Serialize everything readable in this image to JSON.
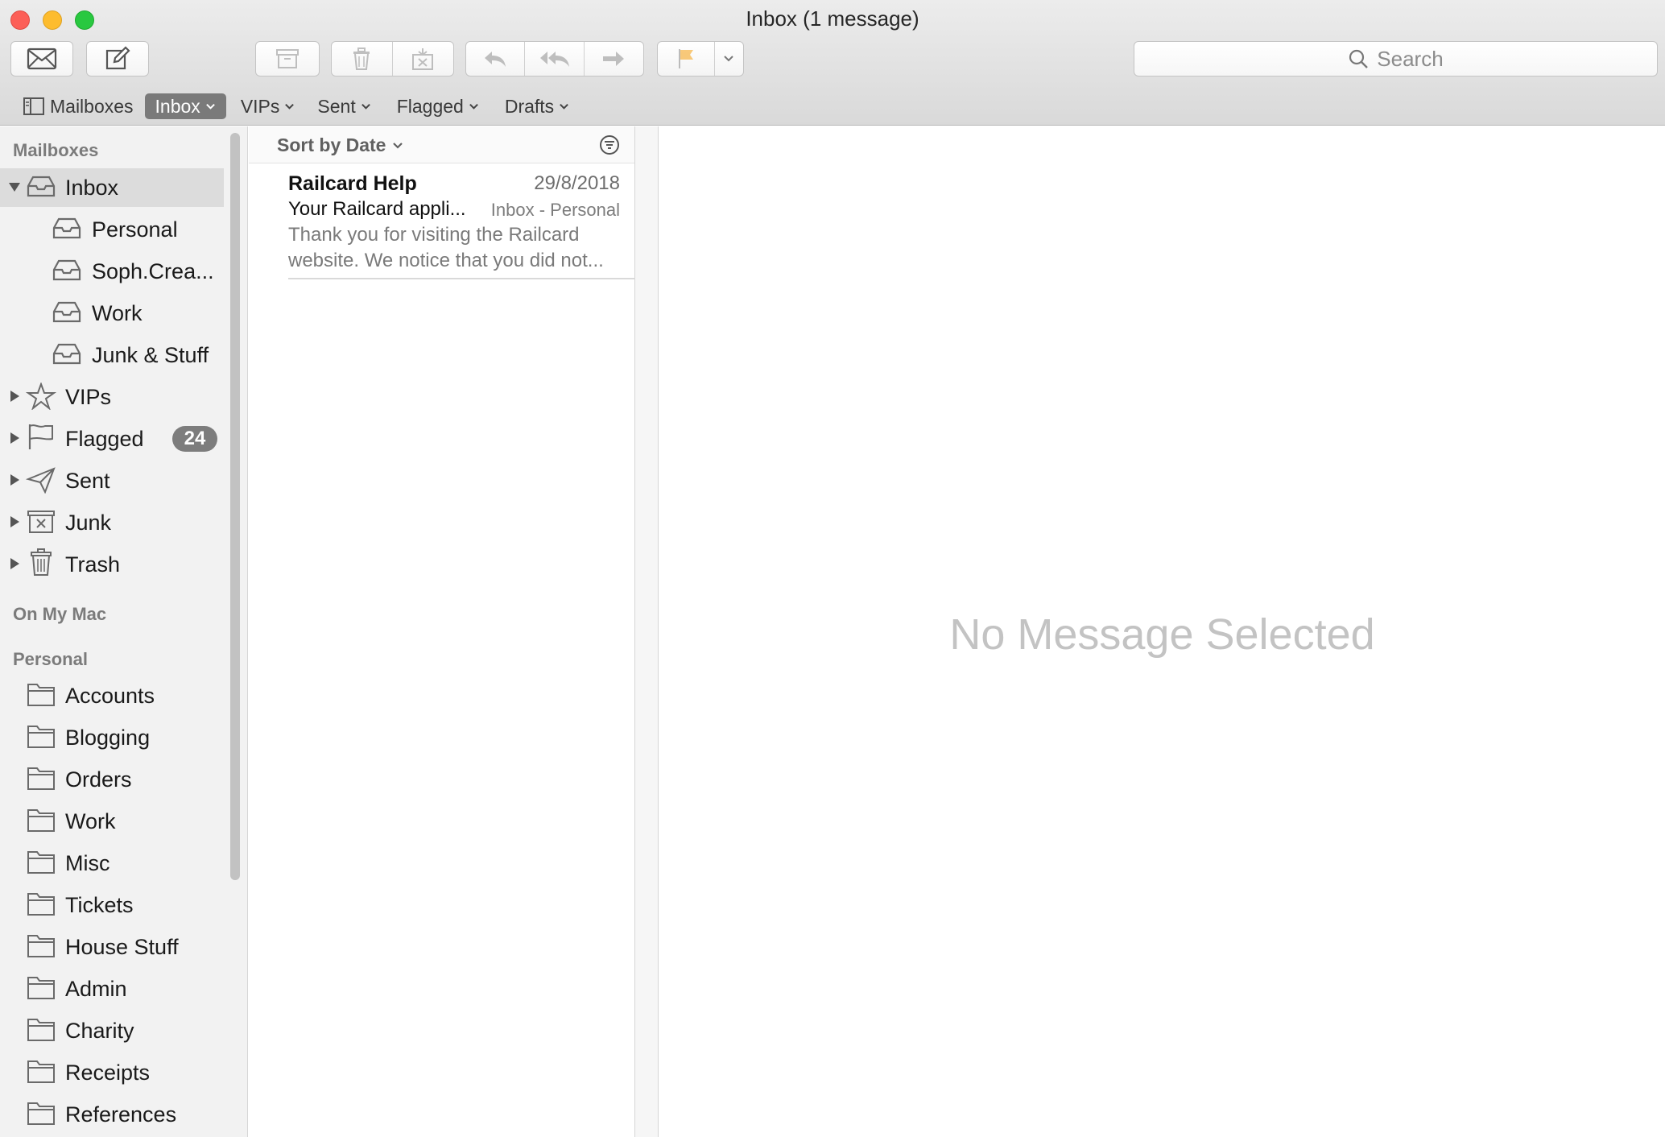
{
  "window": {
    "title": "Inbox (1 message)"
  },
  "toolbar": {
    "icons": [
      "get-mail-icon",
      "compose-icon",
      "archive-icon",
      "trash-icon",
      "junk-icon",
      "reply-icon",
      "reply-all-icon",
      "forward-icon",
      "flag-icon",
      "chevron-down-icon"
    ],
    "flag_color": "#f5a623",
    "search_placeholder": "Search"
  },
  "favorites": {
    "mailboxes": "Mailboxes",
    "inbox": "Inbox",
    "vips": "VIPs",
    "sent": "Sent",
    "flagged": "Flagged",
    "drafts": "Drafts"
  },
  "sidebar": {
    "section_mailboxes": "Mailboxes",
    "inbox": "Inbox",
    "inbox_children": [
      "Personal",
      "Soph.Crea...",
      "Work",
      "Junk & Stuff"
    ],
    "vips": "VIPs",
    "flagged": "Flagged",
    "flagged_count": "24",
    "sent": "Sent",
    "junk": "Junk",
    "trash": "Trash",
    "section_on_my_mac": "On My Mac",
    "section_personal": "Personal",
    "personal_folders": [
      "Accounts",
      "Blogging",
      "Orders",
      "Work",
      "Misc",
      "Tickets",
      "House Stuff",
      "Admin",
      "Charity",
      "Receipts",
      "References"
    ]
  },
  "message_list": {
    "sort_label": "Sort by Date",
    "messages": [
      {
        "from": "Railcard Help",
        "date": "29/8/2018",
        "subject": "Your Railcard appli...",
        "mailbox": "Inbox - Personal",
        "preview": "Thank you for visiting the Railcard website. We notice that you did not..."
      }
    ]
  },
  "viewer": {
    "empty_text": "No Message Selected"
  },
  "colors": {
    "selected_fav": "#7a7a7a",
    "sidebar_bg": "#f2f2f2",
    "badge_bg": "#7d7d7d"
  }
}
